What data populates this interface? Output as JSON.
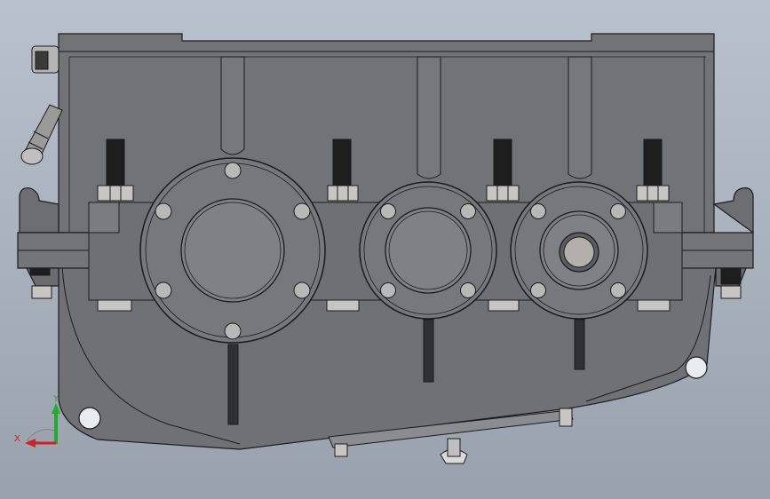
{
  "view": {
    "triad": {
      "x_label": "X",
      "y_label": "Y",
      "x_color": "#d42020",
      "y_color": "#1fae2b",
      "z_color": "#2f56d6"
    }
  },
  "colors": {
    "body": "#6f7175",
    "body_dark": "#5a5c60",
    "edge": "#1b1b1d",
    "flange": "#76787c",
    "bore": "#7f8185",
    "steel": "#b8b8b8",
    "thread": "#1e1e1e",
    "nut": "#c8c6c2",
    "window": "#2f3033"
  },
  "model": {
    "name": "gearbox-housing",
    "bearing_count": 3
  }
}
